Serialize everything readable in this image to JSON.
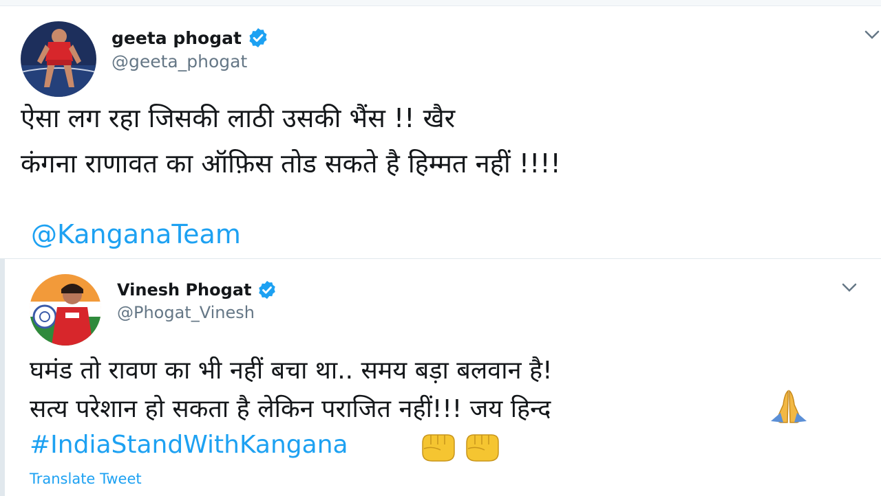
{
  "tweets": [
    {
      "display_name": "geeta phogat",
      "handle": "@geeta_phogat",
      "verified": true,
      "text_lines": [
        "ऐसा लग रहा जिसकी लाठी उसकी भैंस !! खैर",
        "कंगना राणावत का ऑफ़िस तोड सकते है हिम्मत नहीं !!!!"
      ],
      "mention": "@KanganaTeam"
    },
    {
      "display_name": "Vinesh Phogat",
      "handle": "@Phogat_Vinesh",
      "verified": true,
      "text_lines": [
        "घमंड तो रावण का भी नहीं बचा था.. समय बड़ा बलवान है!",
        "सत्य परेशान हो सकता है लेकिन पराजित नहीं!!! जय हिन्द"
      ],
      "hashtag": "#IndiaStandWithKangana",
      "translate_label": "Translate Tweet"
    }
  ],
  "icons": {
    "verified": "verified-badge-icon",
    "menu": "chevron-down-icon",
    "praying_hands": "praying-hands-emoji",
    "fist": "raised-fist-emoji"
  },
  "colors": {
    "link": "#1da1f2",
    "handle": "#657786",
    "text": "#14171a",
    "divider": "#e1e8ed"
  }
}
